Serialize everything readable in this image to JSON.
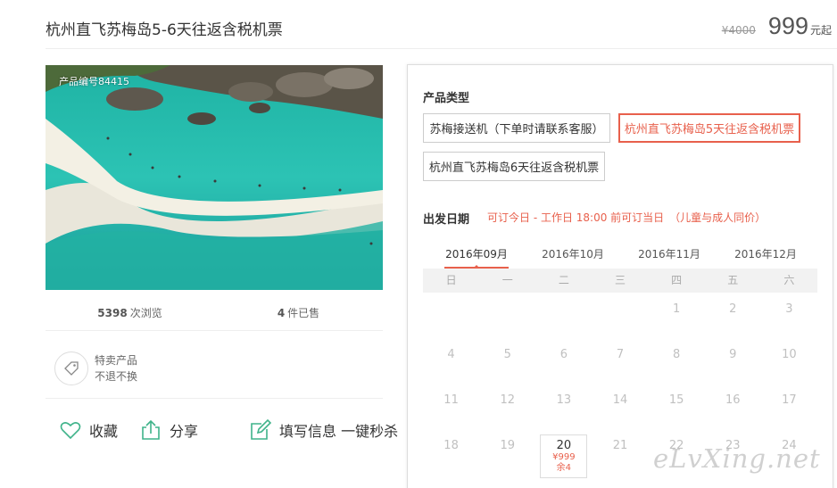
{
  "header": {
    "title": "杭州直飞苏梅岛5-6天往返含税机票",
    "old_price": "¥4000",
    "price": "999",
    "unit": "元起"
  },
  "photo": {
    "product_no": "产品编号84415"
  },
  "stats": {
    "views_num": "5398",
    "views_label": "次浏览",
    "sold_num": "4",
    "sold_label": "件已售"
  },
  "special": {
    "line1": "特卖产品",
    "line2": "不退不换"
  },
  "actions": {
    "favorite": "收藏",
    "share": "分享",
    "fill": "填写信息 一键秒杀"
  },
  "booking": {
    "type_label": "产品类型",
    "options": [
      "苏梅接送机（下单时请联系客服）",
      "杭州直飞苏梅岛5天往返含税机票",
      "杭州直飞苏梅岛6天往返含税机票"
    ],
    "date_label": "出发日期",
    "date_note": "可订今日 - 工作日 18:00 前可订当日　（儿童与成人同价）",
    "months": [
      "2016年09月",
      "2016年10月",
      "2016年11月",
      "2016年12月"
    ],
    "weekdays": [
      "日",
      "一",
      "二",
      "三",
      "四",
      "五",
      "六"
    ],
    "calendar": [
      [
        "",
        "",
        "",
        "",
        "1",
        "2",
        "3"
      ],
      [
        "4",
        "5",
        "6",
        "7",
        "8",
        "9",
        "10"
      ],
      [
        "11",
        "12",
        "13",
        "14",
        "15",
        "16",
        "17"
      ],
      [
        "18",
        "19",
        "20",
        "21",
        "22",
        "23",
        "24"
      ]
    ],
    "special_day": {
      "price": "¥999",
      "remain": "余4"
    }
  },
  "watermark": "eLvXing.net",
  "colors": {
    "accent": "#e8604c",
    "icon": "#3fb38a"
  }
}
